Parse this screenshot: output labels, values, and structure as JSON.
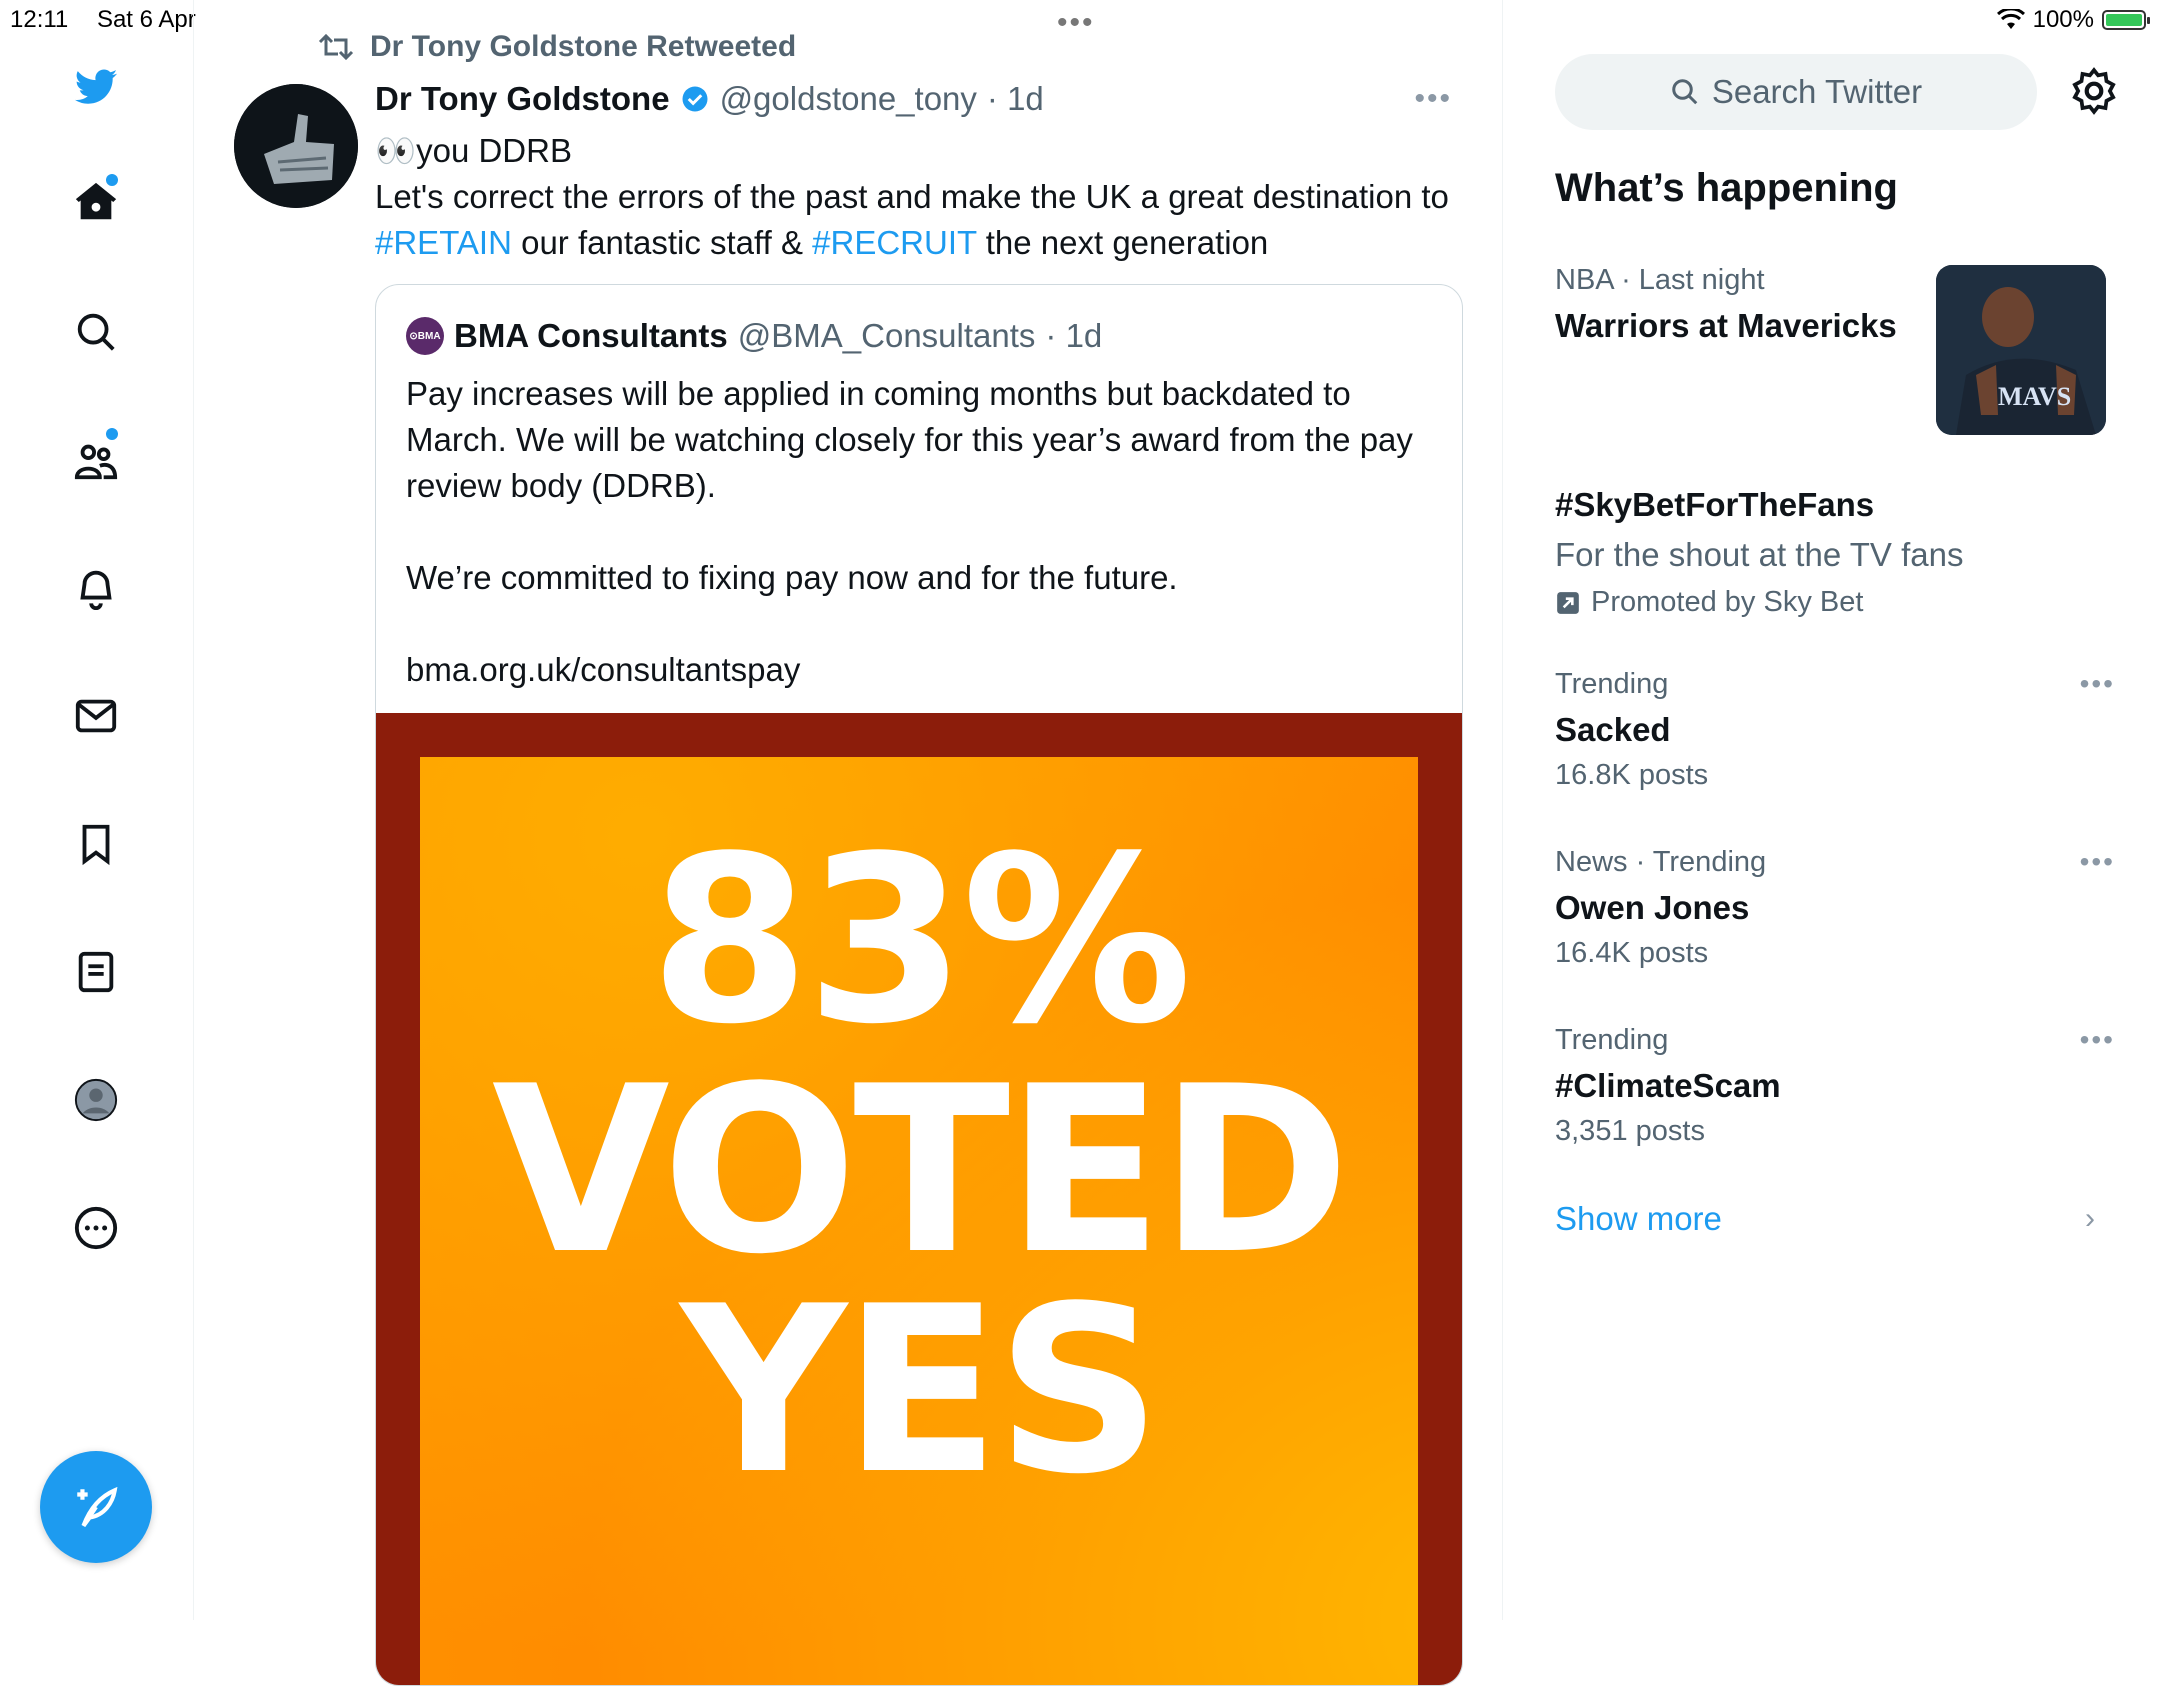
{
  "status": {
    "time": "12:11",
    "date": "Sat 6 Apr",
    "battery": "100%"
  },
  "nav": {
    "items": [
      "home",
      "explore",
      "communities",
      "notifications",
      "messages",
      "bookmarks",
      "lists",
      "profile",
      "more"
    ]
  },
  "tweet": {
    "retweet_line": "Dr Tony Goldstone Retweeted",
    "author_name": "Dr Tony Goldstone",
    "author_handle": "@goldstone_tony",
    "time": "· 1d",
    "line1": "👀you DDRB",
    "text_a": "Let's correct the errors of the past and make the UK a great destination to ",
    "tag1": "#RETAIN",
    "text_b": " our fantastic staff & ",
    "tag2": "#RECRUIT",
    "text_c": " the next generation",
    "quote": {
      "logo_text": "⊙BMA",
      "name": "BMA Consultants",
      "handle": "@BMA_Consultants",
      "time": "· 1d",
      "p1": "Pay increases will be applied in coming months but backdated to March. We will be watching closely for this year’s award from the pay review body (DDRB).",
      "p2": "We’re committed to fixing pay now and for the future.",
      "p3": "bma.org.uk/consultantspay",
      "media": {
        "line1": "83%",
        "line2": "VOTED",
        "line3": "YES"
      }
    }
  },
  "sidebar": {
    "search_placeholder": "Search Twitter",
    "title": "What’s happening",
    "nba": {
      "meta": "NBA · Last night",
      "title": "Warriors at Mavericks"
    },
    "promo": {
      "title": "#SkyBetForTheFans",
      "sub": "For the shout at the TV fans",
      "line": "Promoted by Sky Bet"
    },
    "trends": [
      {
        "meta": "Trending",
        "title": "Sacked",
        "sub": "16.8K posts"
      },
      {
        "meta": "News · Trending",
        "title": "Owen Jones",
        "sub": "16.4K posts"
      },
      {
        "meta": "Trending",
        "title": "#ClimateScam",
        "sub": "3,351 posts"
      }
    ],
    "show_more": "Show more"
  },
  "colors": {
    "accent": "#1d9bf0",
    "secondary_text": "#536471",
    "media_border": "#8c1d0b",
    "media_orange": "#ff9800"
  }
}
